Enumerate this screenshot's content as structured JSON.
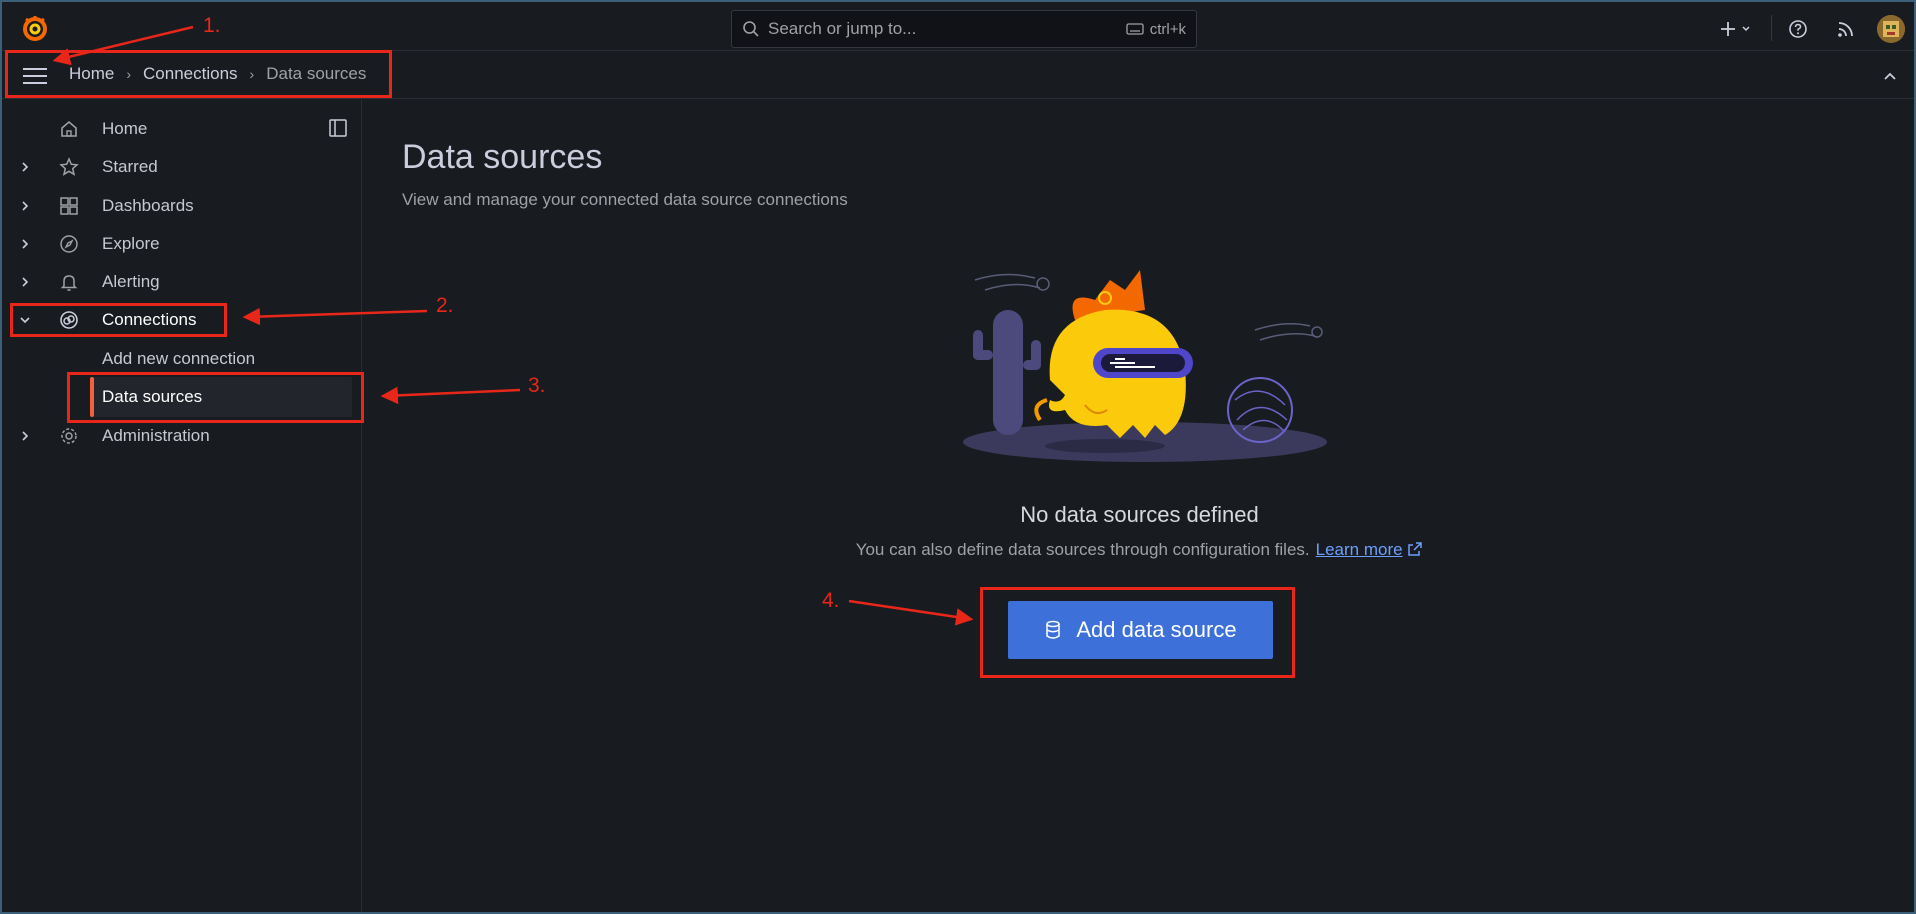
{
  "search": {
    "placeholder": "Search or jump to...",
    "shortcut": "ctrl+k"
  },
  "breadcrumb": {
    "items": [
      "Home",
      "Connections",
      "Data sources"
    ]
  },
  "sidebar": {
    "items": [
      {
        "label": "Home",
        "icon": "home-icon"
      },
      {
        "label": "Starred",
        "icon": "star-icon"
      },
      {
        "label": "Dashboards",
        "icon": "apps-icon"
      },
      {
        "label": "Explore",
        "icon": "compass-icon"
      },
      {
        "label": "Alerting",
        "icon": "bell-icon"
      },
      {
        "label": "Connections",
        "icon": "link-icon",
        "expanded": true
      },
      {
        "label": "Administration",
        "icon": "gear-icon"
      }
    ],
    "sub_items": [
      {
        "label": "Add new connection"
      },
      {
        "label": "Data sources",
        "active": true
      }
    ]
  },
  "main": {
    "title": "Data sources",
    "subtitle": "View and manage your connected data source connections",
    "empty_title": "No data sources defined",
    "empty_desc": "You can also define data sources through configuration files.",
    "learn_more": "Learn more",
    "add_button": "Add data source"
  },
  "annotations": [
    "1.",
    "2.",
    "3.",
    "4."
  ],
  "colors": {
    "accent": "#3d71d9",
    "active_bar": "#f55f3e",
    "annotation": "#e8261a",
    "background": "#181b1f"
  }
}
